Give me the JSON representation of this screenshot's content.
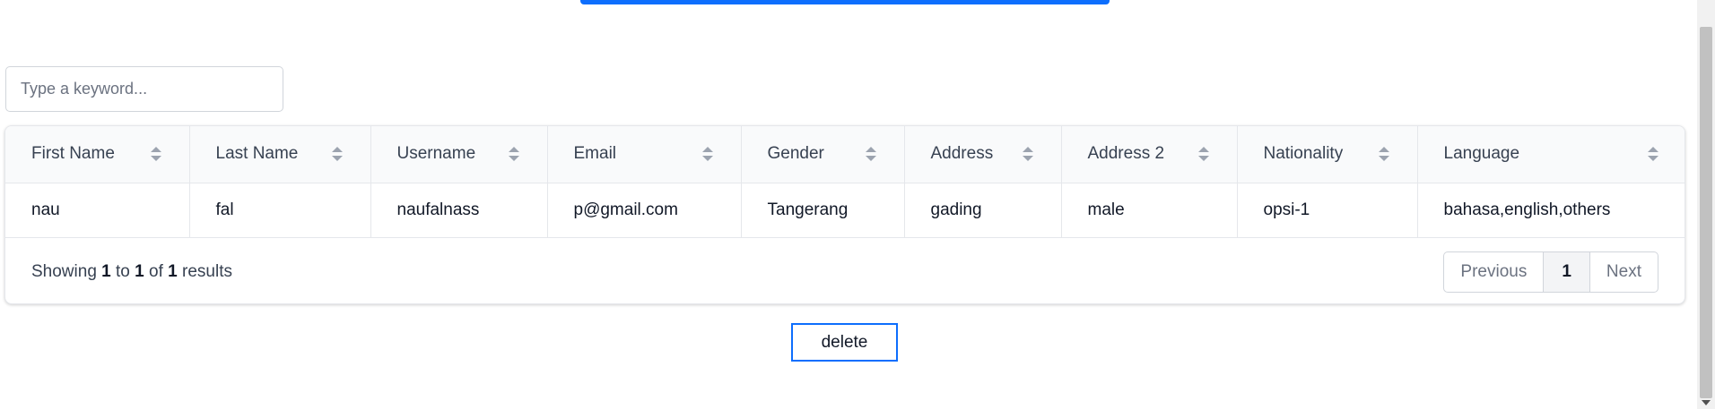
{
  "search": {
    "placeholder": "Type a keyword..."
  },
  "table": {
    "columns": [
      "First Name",
      "Last Name",
      "Username",
      "Email",
      "Gender",
      "Address",
      "Address 2",
      "Nationality",
      "Language"
    ],
    "rows": [
      [
        "nau",
        "fal",
        "naufalnass",
        "p@gmail.com",
        "Tangerang",
        "gading",
        "male",
        "opsi-1",
        "bahasa,english,others"
      ]
    ]
  },
  "footer": {
    "showing_prefix": "Showing",
    "from": "1",
    "to_word": "to",
    "to": "1",
    "of_word": "of",
    "total": "1",
    "results_word": "results"
  },
  "pagination": {
    "previous": "Previous",
    "page": "1",
    "next": "Next"
  },
  "actions": {
    "delete_label": "delete"
  },
  "colors": {
    "accent": "#0d6efd",
    "header_bg": "#f9fafb",
    "border": "#e5e7eb"
  },
  "icons": {
    "sort": "sort-icon"
  }
}
